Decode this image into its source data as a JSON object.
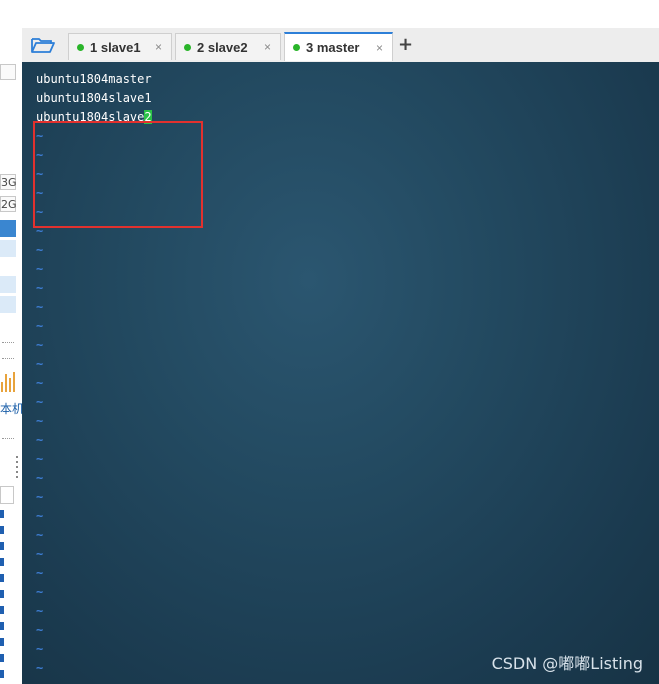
{
  "tabs": [
    {
      "label": "1 slave1",
      "connected": true
    },
    {
      "label": "2 slave2",
      "connected": true
    },
    {
      "label": "3 master",
      "connected": true,
      "active": true
    }
  ],
  "tab_close_glyph": "×",
  "add_tab_glyph": "+",
  "sidebar": {
    "size_box_1": "3G",
    "size_box_2": "2G",
    "partial_label": "本机"
  },
  "terminal": {
    "lines": [
      "ubuntu1804master",
      "ubuntu1804slave1",
      "ubuntu1804slave"
    ],
    "cursor_char": "2",
    "tilde_glyph": "~",
    "tilde_count": 29,
    "accent_cursor_color": "#2bc247",
    "tilde_color": "#3d7cd1"
  },
  "annotation": {
    "highlight_color": "#e2312e"
  },
  "watermark": "CSDN @嘟嘟Listing",
  "icons": {
    "folder": "folder-open-icon",
    "connection": "status-dot-icon",
    "close": "close-icon",
    "add": "plus-icon"
  }
}
